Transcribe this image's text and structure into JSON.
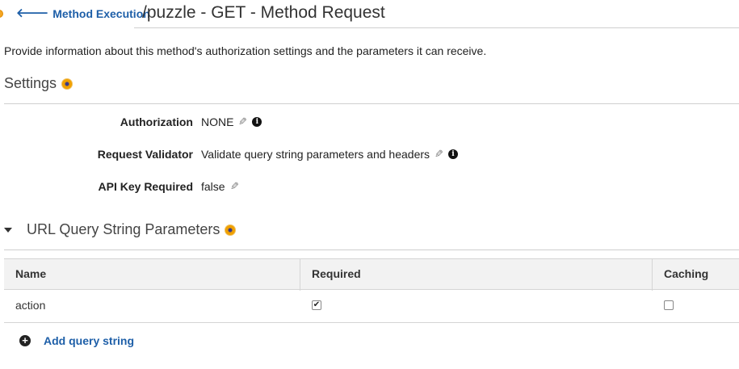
{
  "header": {
    "back_label": "Method Execution",
    "back_icon": "arrow-left-icon",
    "title": "/puzzle - GET - Method Request"
  },
  "intro": "Provide information about this method's authorization settings and the parameters it can receive.",
  "settings": {
    "title": "Settings",
    "rows": [
      {
        "label": "Authorization",
        "value": "NONE"
      },
      {
        "label": "Request Validator",
        "value": "Validate query string parameters and headers"
      },
      {
        "label": "API Key Required",
        "value": "false"
      }
    ]
  },
  "query_params": {
    "title": "URL Query String Parameters",
    "columns": [
      "Name",
      "Required",
      "Caching"
    ],
    "rows": [
      {
        "name": "action",
        "required": true,
        "caching": false
      }
    ],
    "add_label": "Add query string"
  },
  "colors": {
    "link": "#1e5fa8",
    "info_dot": "#f0a000",
    "header_bg": "#f2f2f2"
  }
}
